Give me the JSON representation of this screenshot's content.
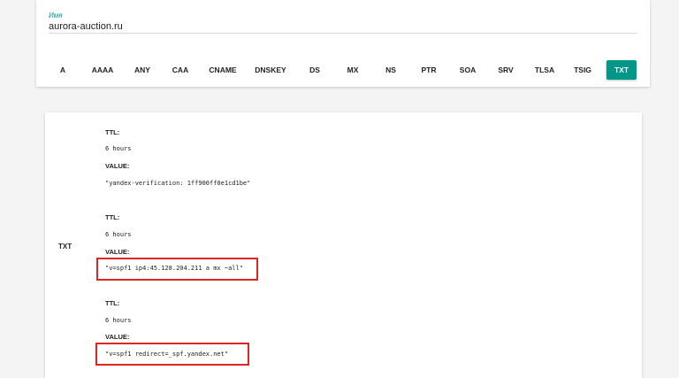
{
  "domain_field": {
    "label": "Имя",
    "value": "aurora-auction.ru"
  },
  "record_types": [
    "A",
    "AAAA",
    "ANY",
    "CAA",
    "CNAME",
    "DNSKEY",
    "DS",
    "MX",
    "NS",
    "PTR",
    "SOA",
    "SRV",
    "TLSA",
    "TSIG",
    "TXT"
  ],
  "selected_type": "TXT",
  "results": {
    "type": "TXT",
    "ttl_label": "TTL:",
    "value_label": "VALUE:",
    "records": [
      {
        "ttl": "6 hours",
        "value": "\"yandex-verification: 1ff900ff0e1cd1be\""
      },
      {
        "ttl": "6 hours",
        "value": "\"v=spf1 ip4:45.128.204.211 a mx ~all\""
      },
      {
        "ttl": "6 hours",
        "value": "\"v=spf1 redirect=_spf.yandex.net\""
      }
    ]
  },
  "highlight_color": "#e02424",
  "accent_color": "#009688"
}
